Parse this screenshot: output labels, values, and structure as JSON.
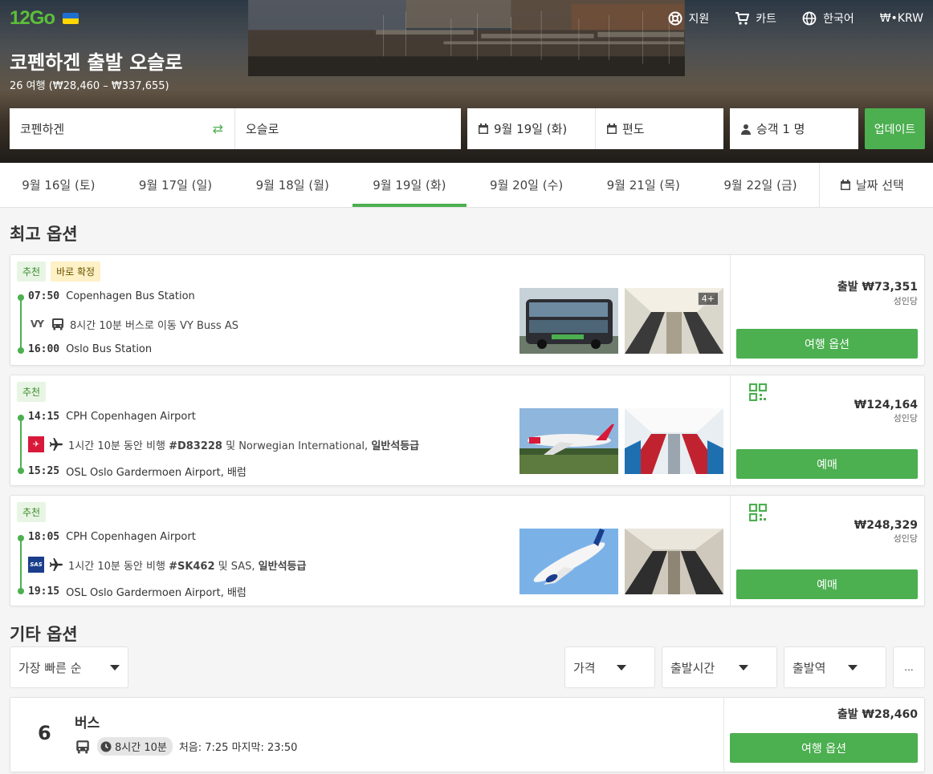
{
  "header": {
    "logo_text": "12Go",
    "nav": {
      "support": "지원",
      "cart": "카트",
      "language": "한국어",
      "currency": "₩•KRW"
    },
    "title": "코펜하겐 출발 오슬로",
    "subtitle": "26 여행 (₩28,460 – ₩337,655)"
  },
  "search": {
    "from": "코펜하겐",
    "to": "오슬로",
    "date": "9월 19일 (화)",
    "trip_type": "편도",
    "passengers": "승객 1 명",
    "update_label": "업데이트"
  },
  "date_tabs": {
    "items": [
      "9월 16일 (토)",
      "9월 17일 (일)",
      "9월 18일 (월)",
      "9월 19일 (화)",
      "9월 20일 (수)",
      "9월 21일 (목)",
      "9월 22일 (금)"
    ],
    "active_index": 3,
    "pick_label": "날짜 선택"
  },
  "best": {
    "heading": "최고 옵션",
    "cards": [
      {
        "tags": {
          "recommended": "추천",
          "instant": "바로 확정"
        },
        "dep_time": "07:50",
        "dep_place": "Copenhagen Bus Station",
        "operator_logo": "VY",
        "mid_text": "8시간 10분 버스로 이동 VY Buss AS",
        "arr_time": "16:00",
        "arr_place": "Oslo Bus Station",
        "photo_badge": "4+",
        "price": "출발 ₩73,351",
        "per": "성인당",
        "button": "여행 옵션"
      },
      {
        "tags": {
          "recommended": "추천"
        },
        "dep_time": "14:15",
        "dep_place": "CPH Copenhagen Airport",
        "mid_pre": "1시간 10분 동안 비행 ",
        "flight": "#D83228",
        "mid_post": " 및 Norwegian International, ",
        "class": "일반석등급",
        "arr_time": "15:25",
        "arr_place": "OSL Oslo Gardermoen Airport, 배럼",
        "price": "₩124,164",
        "per": "성인당",
        "button": "예매"
      },
      {
        "tags": {
          "recommended": "추천"
        },
        "dep_time": "18:05",
        "dep_place": "CPH Copenhagen Airport",
        "operator_logo": "SAS",
        "mid_pre": "1시간 10분 동안 비행 ",
        "flight": "#SK462",
        "mid_post": " 및 SAS, ",
        "class": "일반석등급",
        "arr_time": "19:15",
        "arr_place": "OSL Oslo Gardermoen Airport, 배럼",
        "price": "₩248,329",
        "per": "성인당",
        "button": "예매"
      }
    ]
  },
  "other": {
    "heading": "기타 옵션",
    "sort": "가장 빠른 순",
    "filters": {
      "price": "가격",
      "departure_time": "출발시간",
      "departure_station": "출발역",
      "more": "..."
    },
    "group": {
      "count": "6",
      "type": "버스",
      "duration": "8시간 10분",
      "schedule": "처음: 7:25 마지막: 23:50",
      "price": "출발 ₩28,460",
      "button": "여행 옵션"
    }
  },
  "colors": {
    "accent": "#4caf50",
    "instant_tag": "#fff1c6",
    "recommended_tag": "#e8f5e4"
  }
}
